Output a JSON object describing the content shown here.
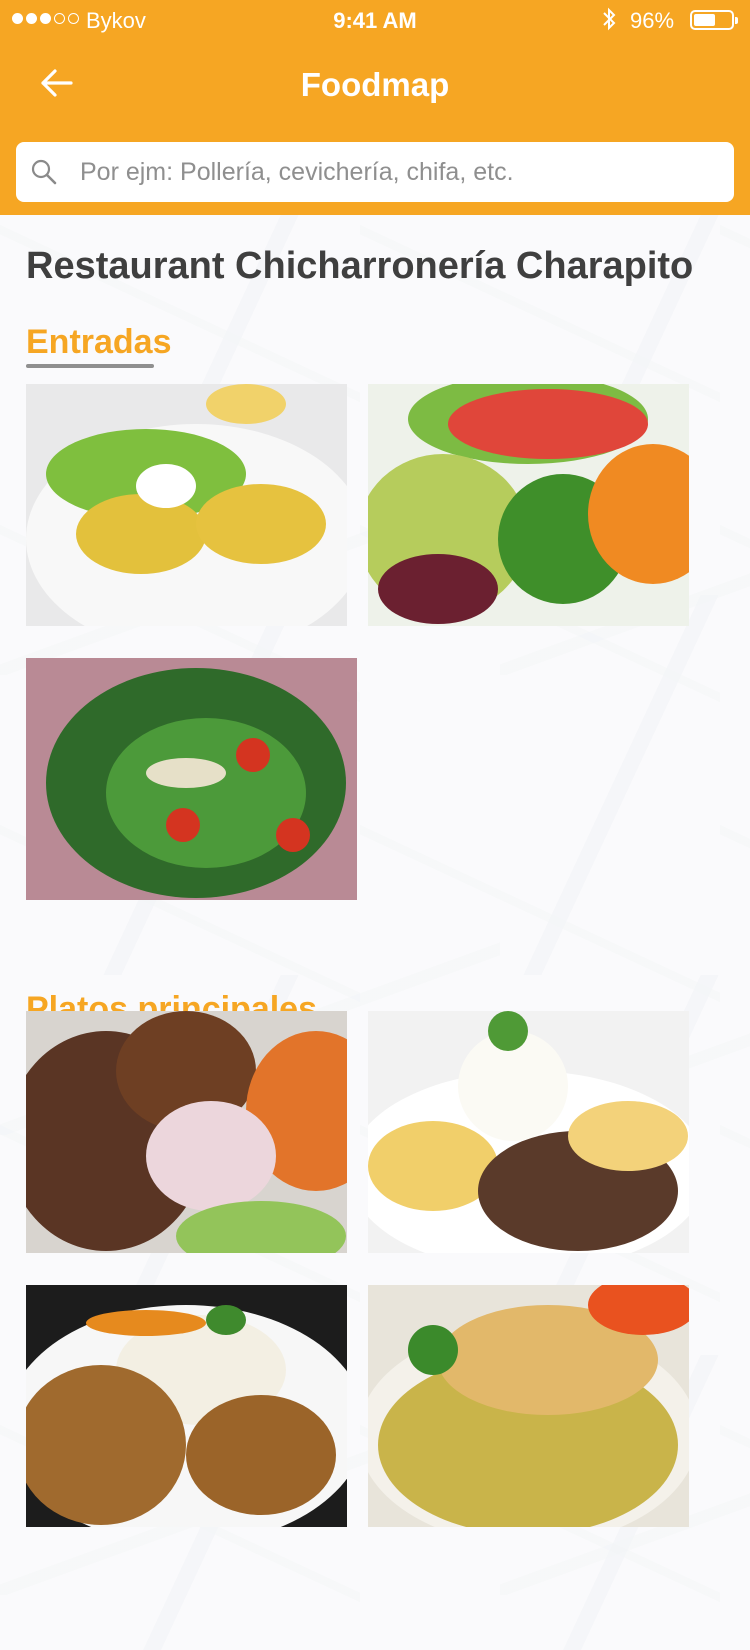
{
  "status_bar": {
    "carrier": "Bykov",
    "time": "9:41 AM",
    "battery": "96%",
    "battery_level": 0.96
  },
  "header": {
    "title": "Foodmap",
    "back_icon": "arrow-left-icon"
  },
  "search": {
    "placeholder": "Por ejm: Pollería, cevichería, chifa, etc.",
    "icon": "search-icon"
  },
  "restaurant": {
    "name": "Restaurant Chicharronería Charapito"
  },
  "sections": [
    {
      "title": "Entradas",
      "items": [
        {
          "image": "causa-rellena-photo"
        },
        {
          "image": "avocado-vegetable-salad-photo"
        },
        {
          "image": "spinach-tomato-salad-photo"
        }
      ]
    },
    {
      "title": "Platos principales",
      "items": [
        {
          "image": "chicharron-sweet-potato-photo"
        },
        {
          "image": "lomo-saltado-photo"
        },
        {
          "image": "seco-de-pato-photo"
        },
        {
          "image": "arroz-con-pollo-photo"
        }
      ]
    }
  ],
  "colors": {
    "accent": "#f6a623",
    "title_text": "#3f3f3f",
    "underline": "#8f8f8f"
  }
}
